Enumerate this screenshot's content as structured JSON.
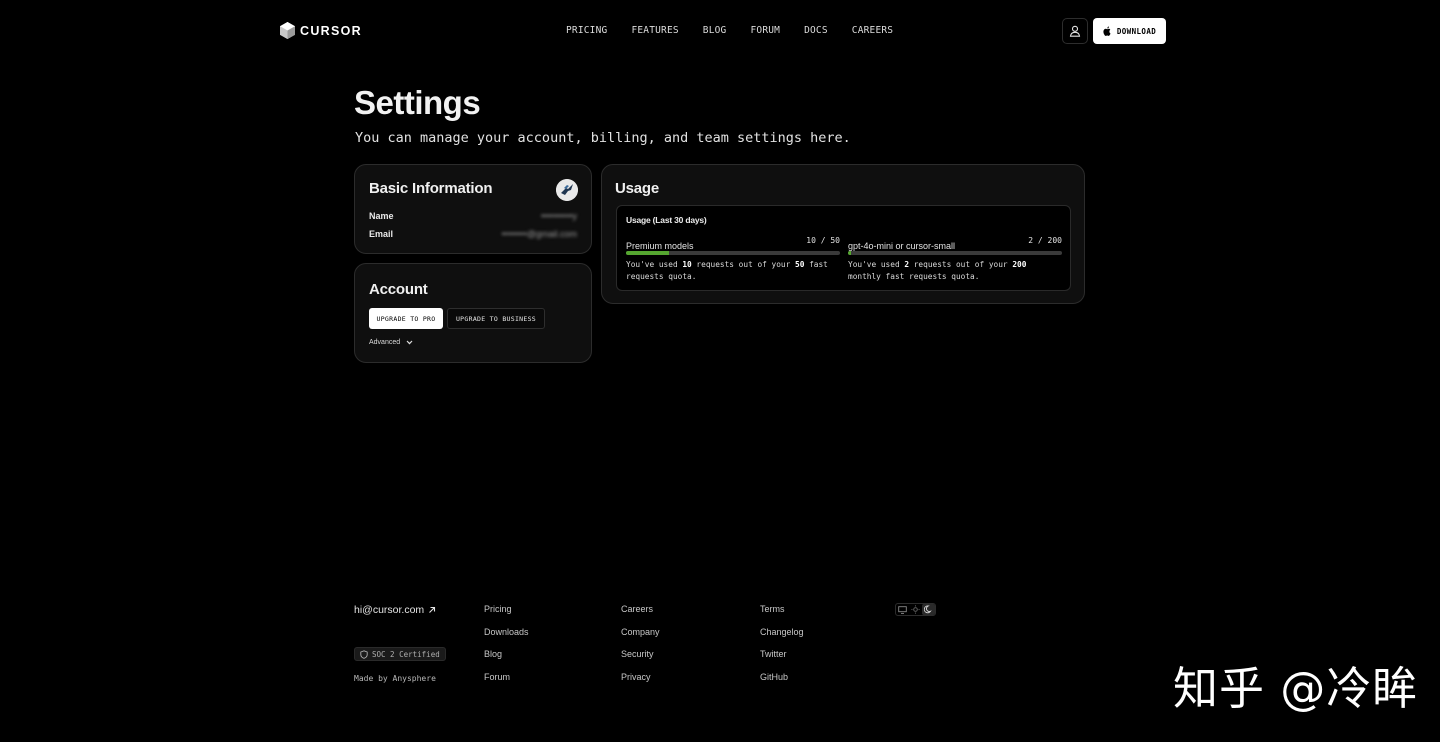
{
  "header": {
    "logo_text": "CURSOR",
    "nav": [
      "PRICING",
      "FEATURES",
      "BLOG",
      "FORUM",
      "DOCS",
      "CAREERS"
    ],
    "download_label": "DOWNLOAD"
  },
  "page": {
    "title": "Settings",
    "subtitle": "You can manage your account, billing, and team settings here."
  },
  "basic_info": {
    "title": "Basic Information",
    "name_label": "Name",
    "name_value": "••••••••••y",
    "email_label": "Email",
    "email_value": "••••••••@gmail.com"
  },
  "account": {
    "title": "Account",
    "upgrade_pro": "UPGRADE TO PRO",
    "upgrade_business": "UPGRADE TO BUSINESS",
    "advanced": "Advanced"
  },
  "usage": {
    "title": "Usage",
    "period": "Usage (Last 30 days)",
    "models": [
      {
        "name": "Premium models",
        "count": "10 / 50",
        "used": 10,
        "limit": 50,
        "desc_pre": "You've used ",
        "desc_used": "10",
        "desc_mid": " requests out of your ",
        "desc_limit": "50",
        "desc_post": " fast requests quota."
      },
      {
        "name": "gpt-4o-mini or cursor-small",
        "count": "2 / 200",
        "used": 2,
        "limit": 200,
        "desc_pre": "You've used ",
        "desc_used": "2",
        "desc_mid": " requests out of your ",
        "desc_limit": "200",
        "desc_post": " monthly fast requests quota."
      }
    ],
    "bar_color": "#55a630"
  },
  "footer": {
    "email": "hi@cursor.com",
    "soc": "SOC 2 Certified",
    "made_by": "Made by Anysphere",
    "col1": [
      "Pricing",
      "Downloads",
      "Blog",
      "Forum"
    ],
    "col2": [
      "Careers",
      "Company",
      "Security",
      "Privacy"
    ],
    "col3": [
      "Terms",
      "Changelog",
      "Twitter",
      "GitHub"
    ]
  },
  "watermark": "知乎 @冷眸"
}
